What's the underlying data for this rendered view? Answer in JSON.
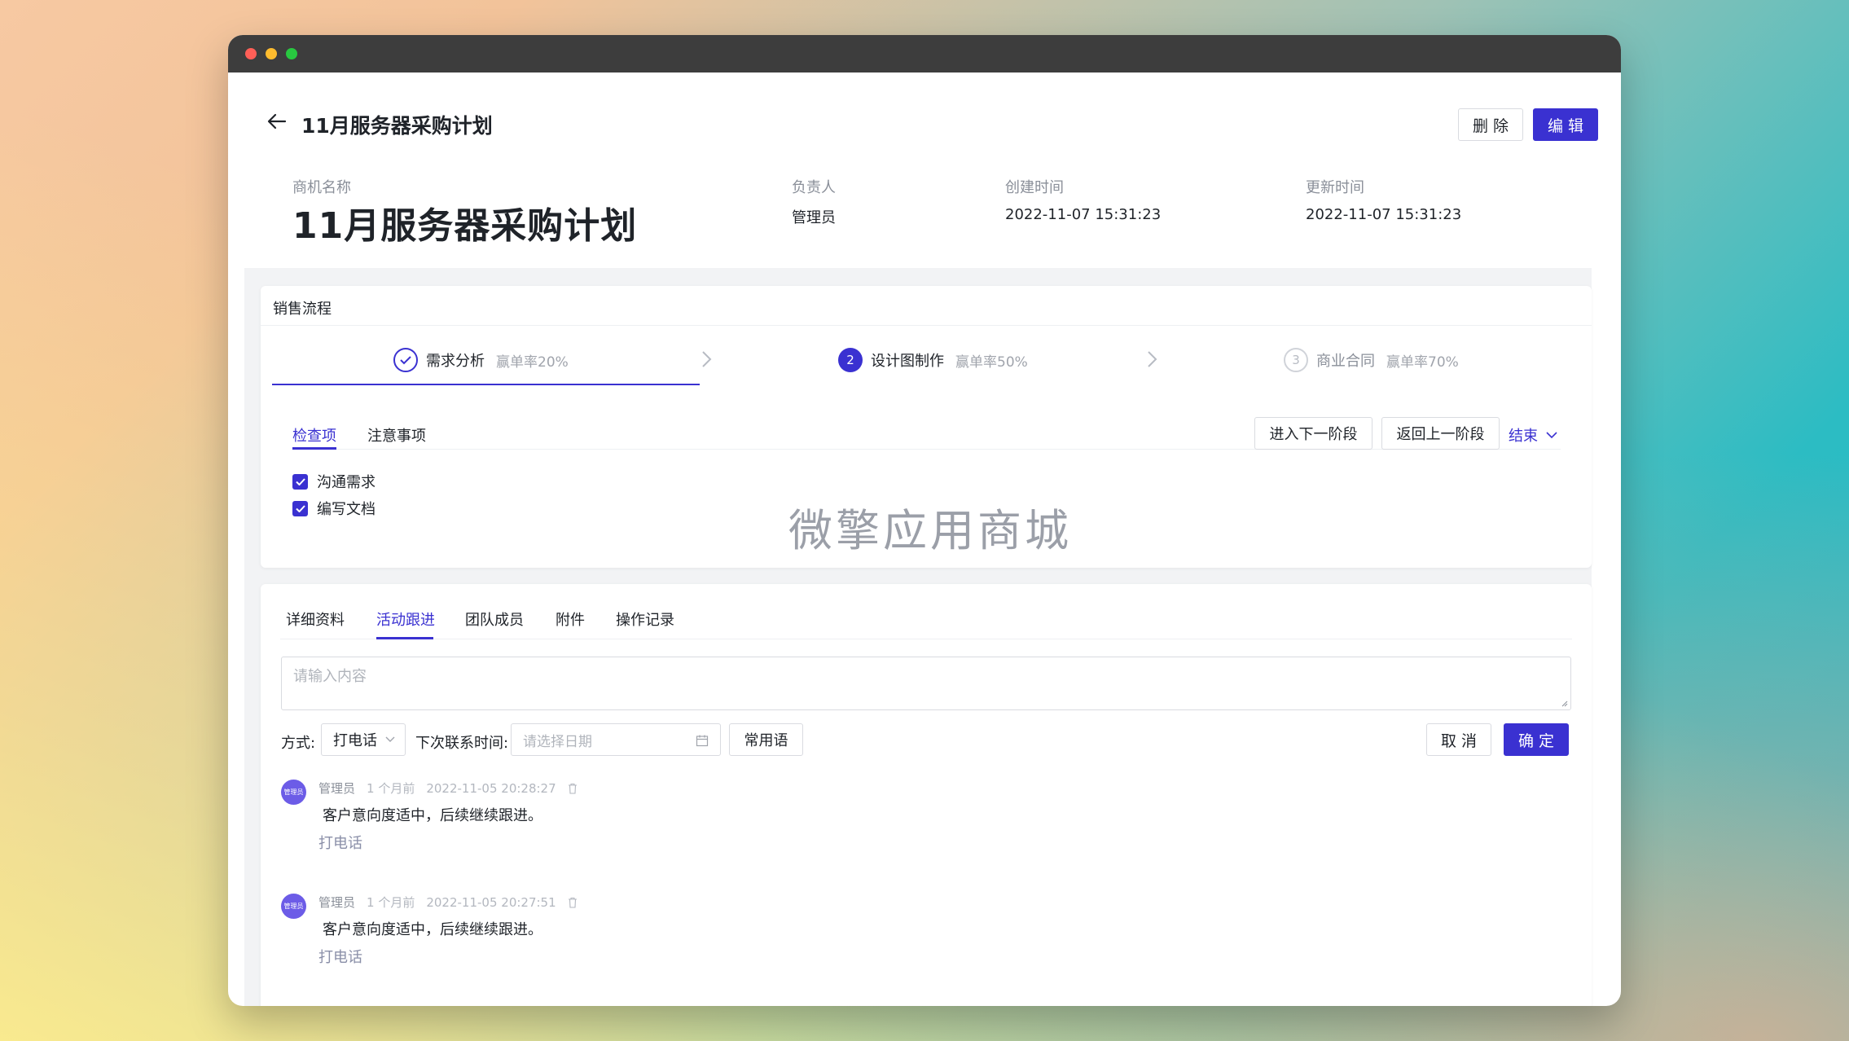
{
  "header": {
    "title": "11月服务器采购计划",
    "delete_label": "删 除",
    "edit_label": "编 辑"
  },
  "info": {
    "name_label": "商机名称",
    "name_value": "11月服务器采购计划",
    "owner_label": "负责人",
    "owner_value": "管理员",
    "created_label": "创建时间",
    "created_value": "2022-11-07 15:31:23",
    "updated_label": "更新时间",
    "updated_value": "2022-11-07 15:31:23"
  },
  "sales_process": {
    "title": "销售流程",
    "steps": [
      {
        "name": "需求分析",
        "rate": "赢单率20%",
        "status": "done",
        "number": ""
      },
      {
        "name": "设计图制作",
        "rate": "赢单率50%",
        "status": "active",
        "number": "2"
      },
      {
        "name": "商业合同",
        "rate": "赢单率70%",
        "status": "wait",
        "number": "3"
      }
    ],
    "subtabs": [
      "检查项",
      "注意事项"
    ],
    "next_stage_label": "进入下一阶段",
    "prev_stage_label": "返回上一阶段",
    "end_label": "结束",
    "checklist": [
      "沟通需求",
      "编写文档"
    ],
    "watermark": "微擎应用商城"
  },
  "detail": {
    "tabs": [
      "详细资料",
      "活动跟进",
      "团队成员",
      "附件",
      "操作记录"
    ],
    "active_tab": "活动跟进",
    "input_placeholder": "请输入内容",
    "method_label": "方式:",
    "method_value": "打电话",
    "next_contact_label": "下次联系时间:",
    "date_placeholder": "请选择日期",
    "phrase_label": "常用语",
    "cancel_label": "取 消",
    "confirm_label": "确 定",
    "activities": [
      {
        "avatar_text": "管理员",
        "user": "管理员",
        "relative": "1 个月前",
        "time": "2022-11-05 20:28:27",
        "content": "客户意向度适中，后续继续跟进。",
        "type": "打电话"
      },
      {
        "avatar_text": "管理员",
        "user": "管理员",
        "relative": "1 个月前",
        "time": "2022-11-05 20:27:51",
        "content": "客户意向度适中，后续继续跟进。",
        "type": "打电话"
      }
    ]
  },
  "colors": {
    "primary": "#3a31d1",
    "titlebar": "#3d3d3d"
  }
}
